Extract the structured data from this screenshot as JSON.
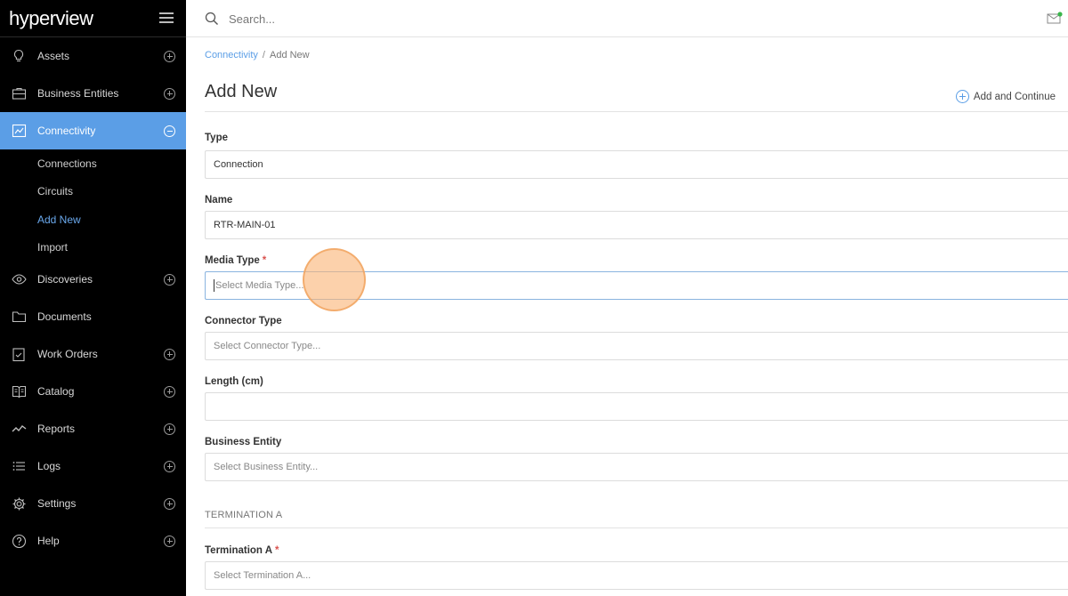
{
  "app": {
    "logo_text": "hyperview"
  },
  "header": {
    "search_placeholder": "Search...",
    "notification_dot_color": "#39b54a"
  },
  "sidebar": {
    "accent_color": "#5b9ee6",
    "items": [
      {
        "label": "Assets",
        "icon": "lightbulb-icon",
        "action": "expand"
      },
      {
        "label": "Business Entities",
        "icon": "briefcase-icon",
        "action": "expand"
      },
      {
        "label": "Connectivity",
        "icon": "network-icon",
        "action": "collapse",
        "active": true
      },
      {
        "label": "Discoveries",
        "icon": "eye-icon",
        "action": "expand"
      },
      {
        "label": "Documents",
        "icon": "folder-icon",
        "action": "none"
      },
      {
        "label": "Work Orders",
        "icon": "clipboard-check-icon",
        "action": "expand"
      },
      {
        "label": "Catalog",
        "icon": "book-icon",
        "action": "expand"
      },
      {
        "label": "Reports",
        "icon": "trend-line-icon",
        "action": "expand"
      },
      {
        "label": "Logs",
        "icon": "list-icon",
        "action": "expand"
      },
      {
        "label": "Settings",
        "icon": "gear-icon",
        "action": "expand"
      },
      {
        "label": "Help",
        "icon": "help-circle-icon",
        "action": "expand"
      }
    ],
    "subitems": [
      {
        "label": "Connections"
      },
      {
        "label": "Circuits"
      },
      {
        "label": "Add New",
        "current": true
      },
      {
        "label": "Import"
      }
    ]
  },
  "breadcrumb": {
    "parent": "Connectivity",
    "separator": "/",
    "current": "Add New"
  },
  "page": {
    "title": "Add New",
    "add_continue_label": "Add and Continue"
  },
  "form": {
    "type": {
      "label": "Type",
      "value": "Connection"
    },
    "name": {
      "label": "Name",
      "value": "RTR-MAIN-01"
    },
    "media_type": {
      "label": "Media Type",
      "required_mark": "*",
      "placeholder": "Select Media Type..."
    },
    "connector_type": {
      "label": "Connector Type",
      "placeholder": "Select Connector Type..."
    },
    "length": {
      "label": "Length (cm)",
      "value": ""
    },
    "business_entity": {
      "label": "Business Entity",
      "placeholder": "Select Business Entity..."
    },
    "termination_section": "TERMINATION A",
    "termination_a": {
      "label": "Termination A",
      "required_mark": "*",
      "placeholder": "Select Termination A..."
    }
  }
}
